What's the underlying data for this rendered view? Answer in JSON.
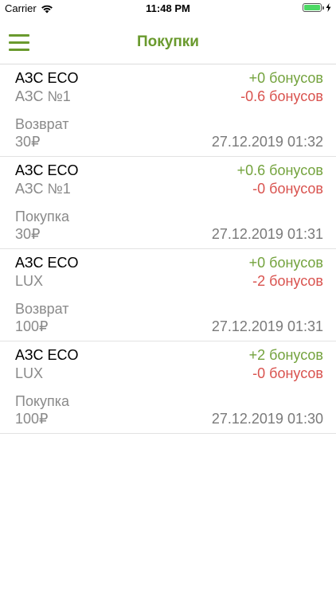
{
  "status_bar": {
    "carrier": "Carrier",
    "time": "11:48 PM",
    "battery_level": 1.0,
    "battery_color": "#4cd964"
  },
  "nav": {
    "title": "Покупки",
    "menu_icon": "hamburger-menu-icon",
    "accent_color": "#6a9a2e"
  },
  "transactions": [
    {
      "station": "АЗС ECO",
      "fuel": "АЗС №1",
      "type": "Возврат",
      "amount": "30₽",
      "bonus_plus": "+0 бонусов",
      "bonus_minus": "-0.6 бонусов",
      "date": "27.12.2019 01:32"
    },
    {
      "station": "АЗС ECO",
      "fuel": "АЗС №1",
      "type": "Покупка",
      "amount": "30₽",
      "bonus_plus": "+0.6 бонусов",
      "bonus_minus": "-0 бонусов",
      "date": "27.12.2019 01:31"
    },
    {
      "station": "АЗС ECO",
      "fuel": "LUX",
      "type": "Возврат",
      "amount": "100₽",
      "bonus_plus": "+0 бонусов",
      "bonus_minus": "-2 бонусов",
      "date": "27.12.2019 01:31"
    },
    {
      "station": "АЗС ECO",
      "fuel": "LUX",
      "type": "Покупка",
      "amount": "100₽",
      "bonus_plus": "+2 бонусов",
      "bonus_minus": "-0 бонусов",
      "date": "27.12.2019 01:30"
    }
  ]
}
